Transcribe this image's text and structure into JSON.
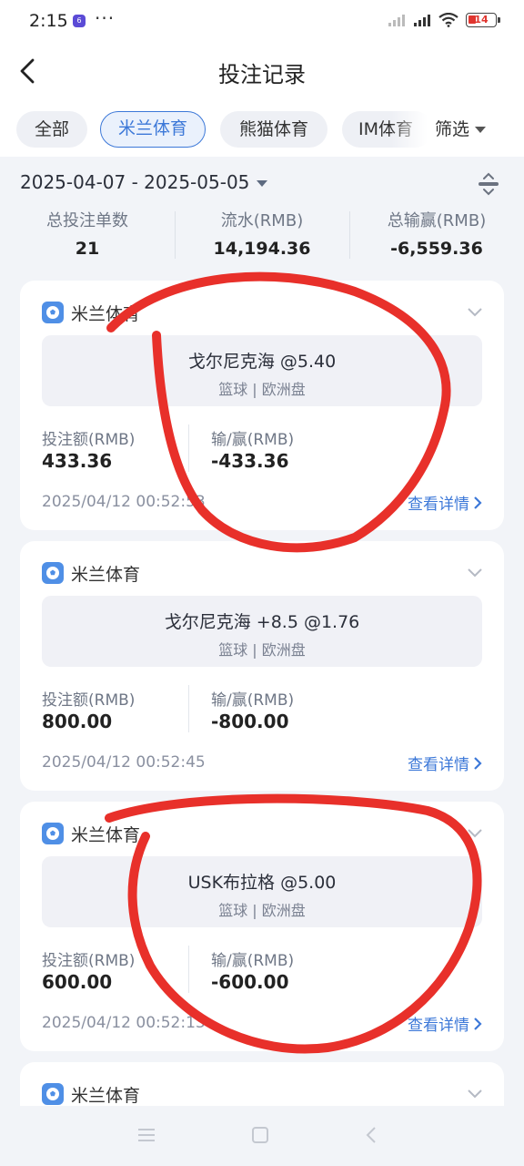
{
  "status": {
    "time": "2:15",
    "app_badge": "6",
    "dots": "···",
    "battery": "14"
  },
  "header": {
    "title": "投注记录"
  },
  "tabs": [
    {
      "label": "全部"
    },
    {
      "label": "米兰体育"
    },
    {
      "label": "熊猫体育"
    },
    {
      "label": "IM体育"
    }
  ],
  "filter_label": "筛选",
  "date_range": "2025-04-07 - 2025-05-05",
  "summary": [
    {
      "label": "总投注单数",
      "value": "21"
    },
    {
      "label": "流水(RMB)",
      "value": "14,194.36"
    },
    {
      "label": "总输赢(RMB)",
      "value": "-6,559.36"
    }
  ],
  "bet_labels": {
    "stake": "投注额(RMB)",
    "win_loss": "输/赢(RMB)",
    "details": "查看详情"
  },
  "bets": [
    {
      "platform": "米兰体育",
      "match": "戈尔尼克海 @5.40",
      "sub": "篮球 | 欧洲盘",
      "stake": "433.36",
      "result": "-433.36",
      "time": "2025/04/12 00:52:53"
    },
    {
      "platform": "米兰体育",
      "match": "戈尔尼克海 +8.5 @1.76",
      "sub": "篮球 | 欧洲盘",
      "stake": "800.00",
      "result": "-800.00",
      "time": "2025/04/12 00:52:45"
    },
    {
      "platform": "米兰体育",
      "match": "USK布拉格 @5.00",
      "sub": "篮球 | 欧洲盘",
      "stake": "600.00",
      "result": "-600.00",
      "time": "2025/04/12 00:52:13"
    },
    {
      "platform": "米兰体育"
    }
  ],
  "colors": {
    "accent": "#3c78d8",
    "annotation": "#e8302a",
    "background": "#f2f4f8"
  }
}
